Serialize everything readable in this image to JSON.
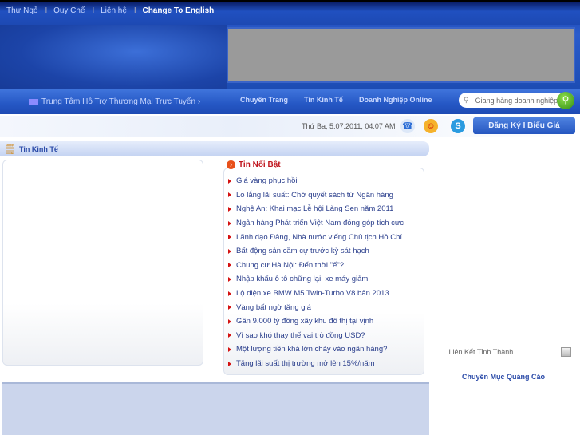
{
  "top_links": {
    "items": [
      "Thư Ngỏ",
      "Quy Chế",
      "Liên hệ"
    ],
    "english": "Change To English"
  },
  "header": {
    "center_link": "Trung Tâm Hỗ Trợ Thương Mại Trực Tuyến ›"
  },
  "nav": {
    "items": [
      "Chuyên Trang",
      "Tin Kinh Tế",
      "Doanh Nghiệp Online"
    ]
  },
  "search": {
    "placeholder": "Giang hàng doanh nghiệp",
    "icon": "search-icon"
  },
  "status": {
    "date": "Thứ Ba, 5.07.2011, 04:07 AM",
    "register": "Đăng Ký  I  Biểu Giá"
  },
  "section": {
    "title": "Tin Kinh Tế"
  },
  "hot_news": {
    "title": "Tin Nổi Bật",
    "items": [
      "Giá vàng phục hồi",
      "Lo lắng lãi suất: Chờ quyết sách từ Ngân hàng",
      "Nghệ An: Khai mạc Lễ hội Làng Sen năm 2011",
      "Ngân hàng Phát triển Việt Nam đóng góp tích cực",
      "Lãnh đạo Đảng, Nhà nước viếng Chủ tịch Hồ Chí",
      "Bất động sản cầm cự trước kỳ sát hạch",
      "Chung cư Hà Nội: Đến thời \"ế\"?",
      "Nhập khẩu ô tô chững lại, xe máy giảm",
      "Lộ diện xe BMW M5 Twin-Turbo V8 bản 2013",
      "Vàng bất ngờ tăng giá",
      "Gần 9.000 tỷ đồng xây khu đô thị tại vịnh",
      "Vì sao khó thay thế vai trò đồng USD?",
      "Một lượng tiền khá lớn chảy vào ngân hàng?",
      "Tăng lãi suất thị trường mở lên 15%/năm"
    ]
  },
  "sidebar": {
    "province_select": "...Liên Kết Tỉnh Thành...",
    "ads_title": "Chuyên Mục Quảng Cáo"
  }
}
